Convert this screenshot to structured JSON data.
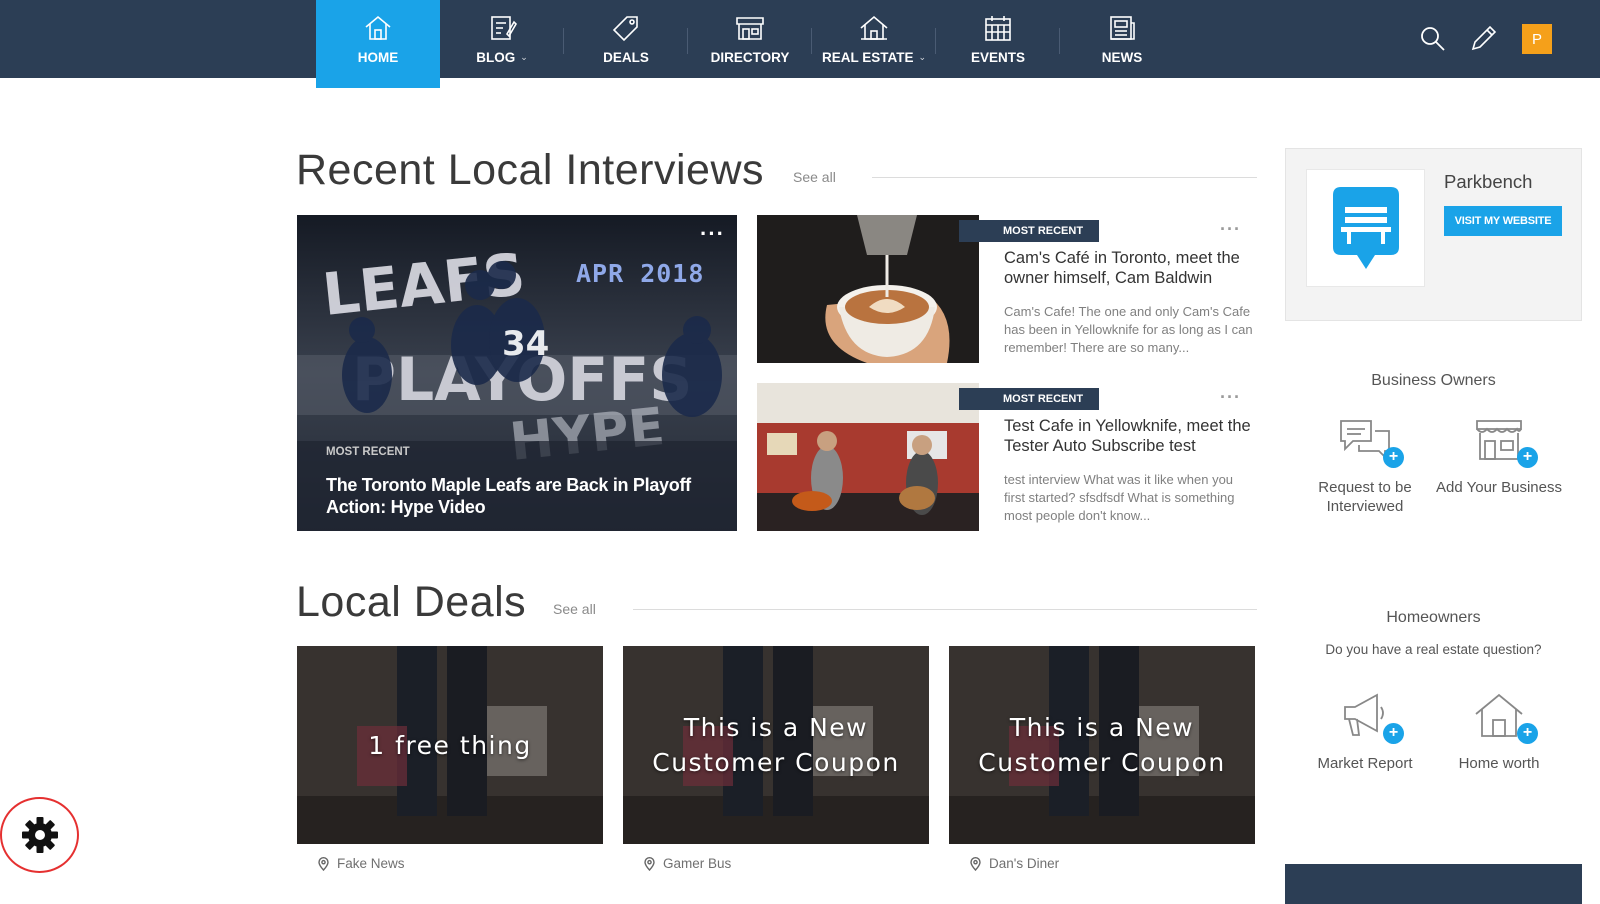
{
  "nav": {
    "items": [
      {
        "label": "HOME",
        "icon": "home-icon",
        "active": true
      },
      {
        "label": "BLOG",
        "icon": "blog-icon",
        "dropdown": true
      },
      {
        "label": "DEALS",
        "icon": "tag-icon"
      },
      {
        "label": "DIRECTORY",
        "icon": "storefront-icon"
      },
      {
        "label": "REAL ESTATE",
        "icon": "house-icon",
        "dropdown": true
      },
      {
        "label": "EVENTS",
        "icon": "calendar-icon"
      },
      {
        "label": "NEWS",
        "icon": "newspaper-icon"
      }
    ],
    "avatar_letter": "P",
    "colors": {
      "bar": "#2c3e55",
      "active": "#1aa3e8",
      "avatar": "#f5a01a"
    }
  },
  "interviews": {
    "title": "Recent Local Interviews",
    "see_all": "See all",
    "feature": {
      "badge": "MOST RECENT",
      "title": "The Toronto Maple Leafs are Back in Playoff Action: Hype Video",
      "image_text": "APR 2018"
    },
    "cards": [
      {
        "badge": "MOST RECENT",
        "title": "Cam's Café in Toronto, meet the owner himself, Cam Baldwin",
        "excerpt": "Cam's Cafe! The one and only Cam's Cafe has been in Yellowknife for as long as I can remember! There are so many..."
      },
      {
        "badge": "MOST RECENT",
        "title": "Test Cafe in Yellowknife, meet the Tester Auto Subscribe test",
        "excerpt": "test interview What was it like when you first started? sfsdfsdf What is something most people don't know..."
      }
    ]
  },
  "deals": {
    "title": "Local Deals",
    "see_all": "See all",
    "items": [
      {
        "text": "1 free thing",
        "location": "Fake News"
      },
      {
        "text": "This is a New Customer Coupon",
        "location": "Gamer Bus"
      },
      {
        "text": "This is a New Customer Coupon",
        "location": "Dan's Diner"
      }
    ]
  },
  "sidebar": {
    "business_name": "Parkbench",
    "visit_button": "VISIT MY WEBSITE",
    "business_owners": {
      "heading": "Business Owners",
      "actions": [
        {
          "label": "Request to be Interviewed",
          "icon": "chat-bubbles-icon"
        },
        {
          "label": "Add Your Business",
          "icon": "storefront-icon"
        }
      ]
    },
    "homeowners": {
      "heading": "Homeowners",
      "question": "Do you have a real estate question?",
      "actions": [
        {
          "label": "Market Report",
          "icon": "megaphone-icon"
        },
        {
          "label": "Home worth",
          "icon": "house-icon"
        }
      ]
    }
  }
}
